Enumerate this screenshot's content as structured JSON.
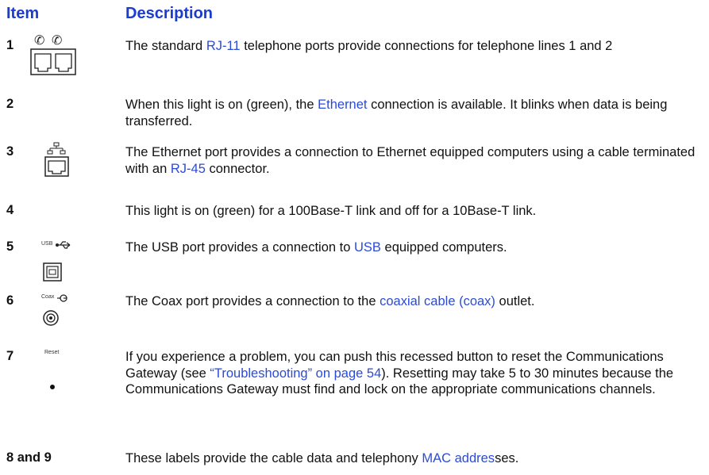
{
  "headers": {
    "item": "Item",
    "description": "Description"
  },
  "rows": [
    {
      "item": "1",
      "icon": "rj11-telephone-ports-icon",
      "parts": [
        "The standard ",
        "RJ-11",
        " telephone ports provide connections for telephone lines 1 and 2"
      ]
    },
    {
      "item": "2",
      "parts": [
        "When this light is on (green), the ",
        "Ethernet",
        " connection is available. It blinks when data is being transferred."
      ]
    },
    {
      "item": "3",
      "icon": "ethernet-port-icon",
      "parts": [
        "The Ethernet port provides a connection to Ethernet equipped computers using a cable terminated with an ",
        "RJ-45",
        " connector."
      ]
    },
    {
      "item": "4",
      "text": "This light is on (green) for a 100Base-T link and off for a 10Base-T link."
    },
    {
      "item": "5",
      "icon": "usb-port-icon",
      "icon_label": "USB",
      "parts": [
        "The USB port provides a connection to ",
        "USB",
        " equipped computers."
      ]
    },
    {
      "item": "6",
      "icon": "coax-port-icon",
      "icon_label": "Coax",
      "parts": [
        "The Coax port provides a connection to the ",
        "coaxial cable (coax)",
        " outlet."
      ]
    },
    {
      "item": "7",
      "icon": "reset-button-icon",
      "icon_label": "Reset",
      "parts": [
        "If you experience a problem, you can push this recessed button to reset the Communications Gateway (see ",
        "“Troubleshooting” on page 54",
        "). Resetting may take 5 to 30 minutes because the Communications Gateway must find and lock on the appropriate communications channels."
      ]
    },
    {
      "item": "8 and 9",
      "parts": [
        "These labels provide the cable data and telephony ",
        "MAC addres",
        "ses."
      ]
    }
  ],
  "colors": {
    "heading": "#1a3ccf",
    "link": "#2b4bd6",
    "text": "#111111"
  }
}
